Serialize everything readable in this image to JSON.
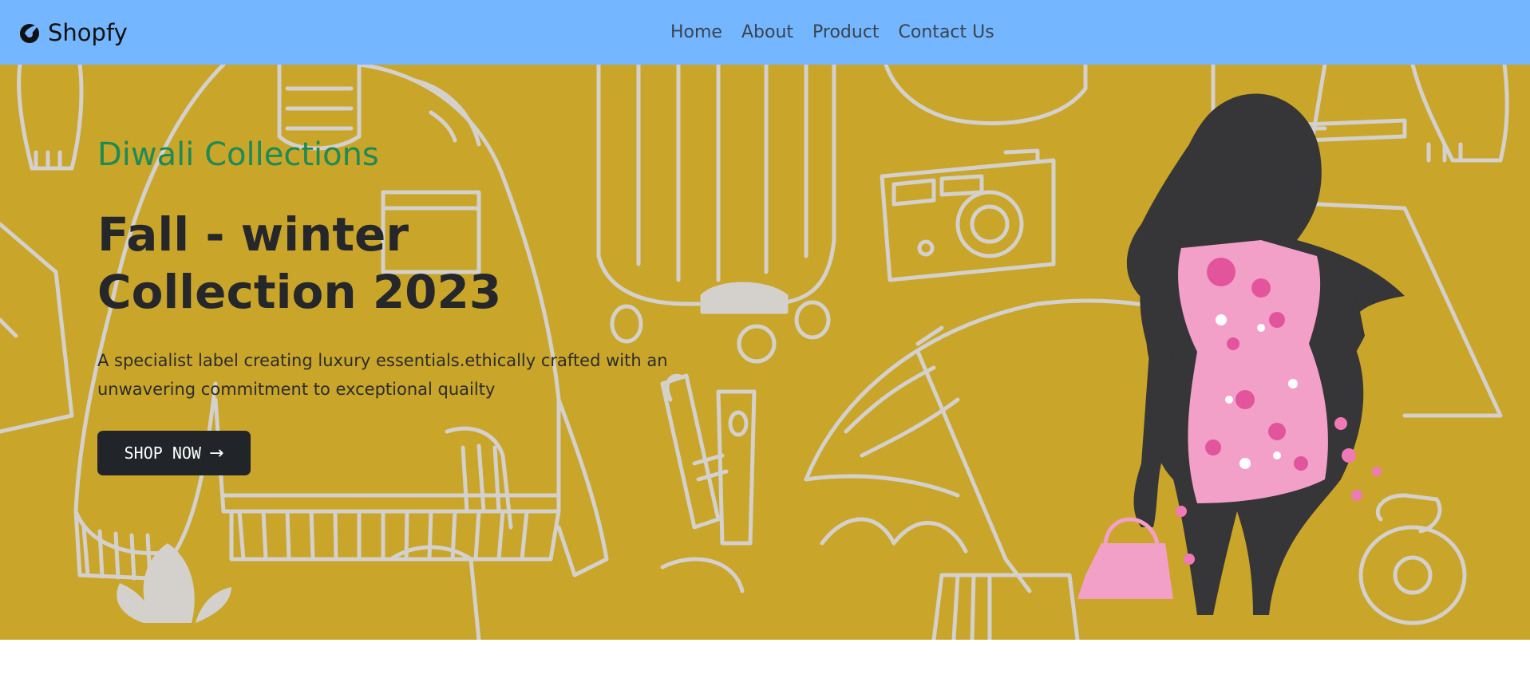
{
  "brand": {
    "name": "Shopfy",
    "logo_icon": "bird-logo-icon"
  },
  "nav": {
    "items": [
      {
        "label": "Home"
      },
      {
        "label": "About"
      },
      {
        "label": "Product"
      },
      {
        "label": "Contact Us"
      }
    ]
  },
  "hero": {
    "subtitle": "Diwali Collections",
    "title_line1": "Fall - winter",
    "title_line2": "Collection 2023",
    "description": "A specialist label creating luxury essentials.ethically crafted with an unwavering commitment to exceptional quailty",
    "button_label": "SHOP NOW",
    "button_icon": "arrow-right-icon",
    "background_color": "#c9a52a",
    "illustration": "woman-in-floral-dress-illustration"
  },
  "colors": {
    "navbar": "#74b6ff",
    "accent_green": "#1e8a55",
    "button": "#212529"
  }
}
